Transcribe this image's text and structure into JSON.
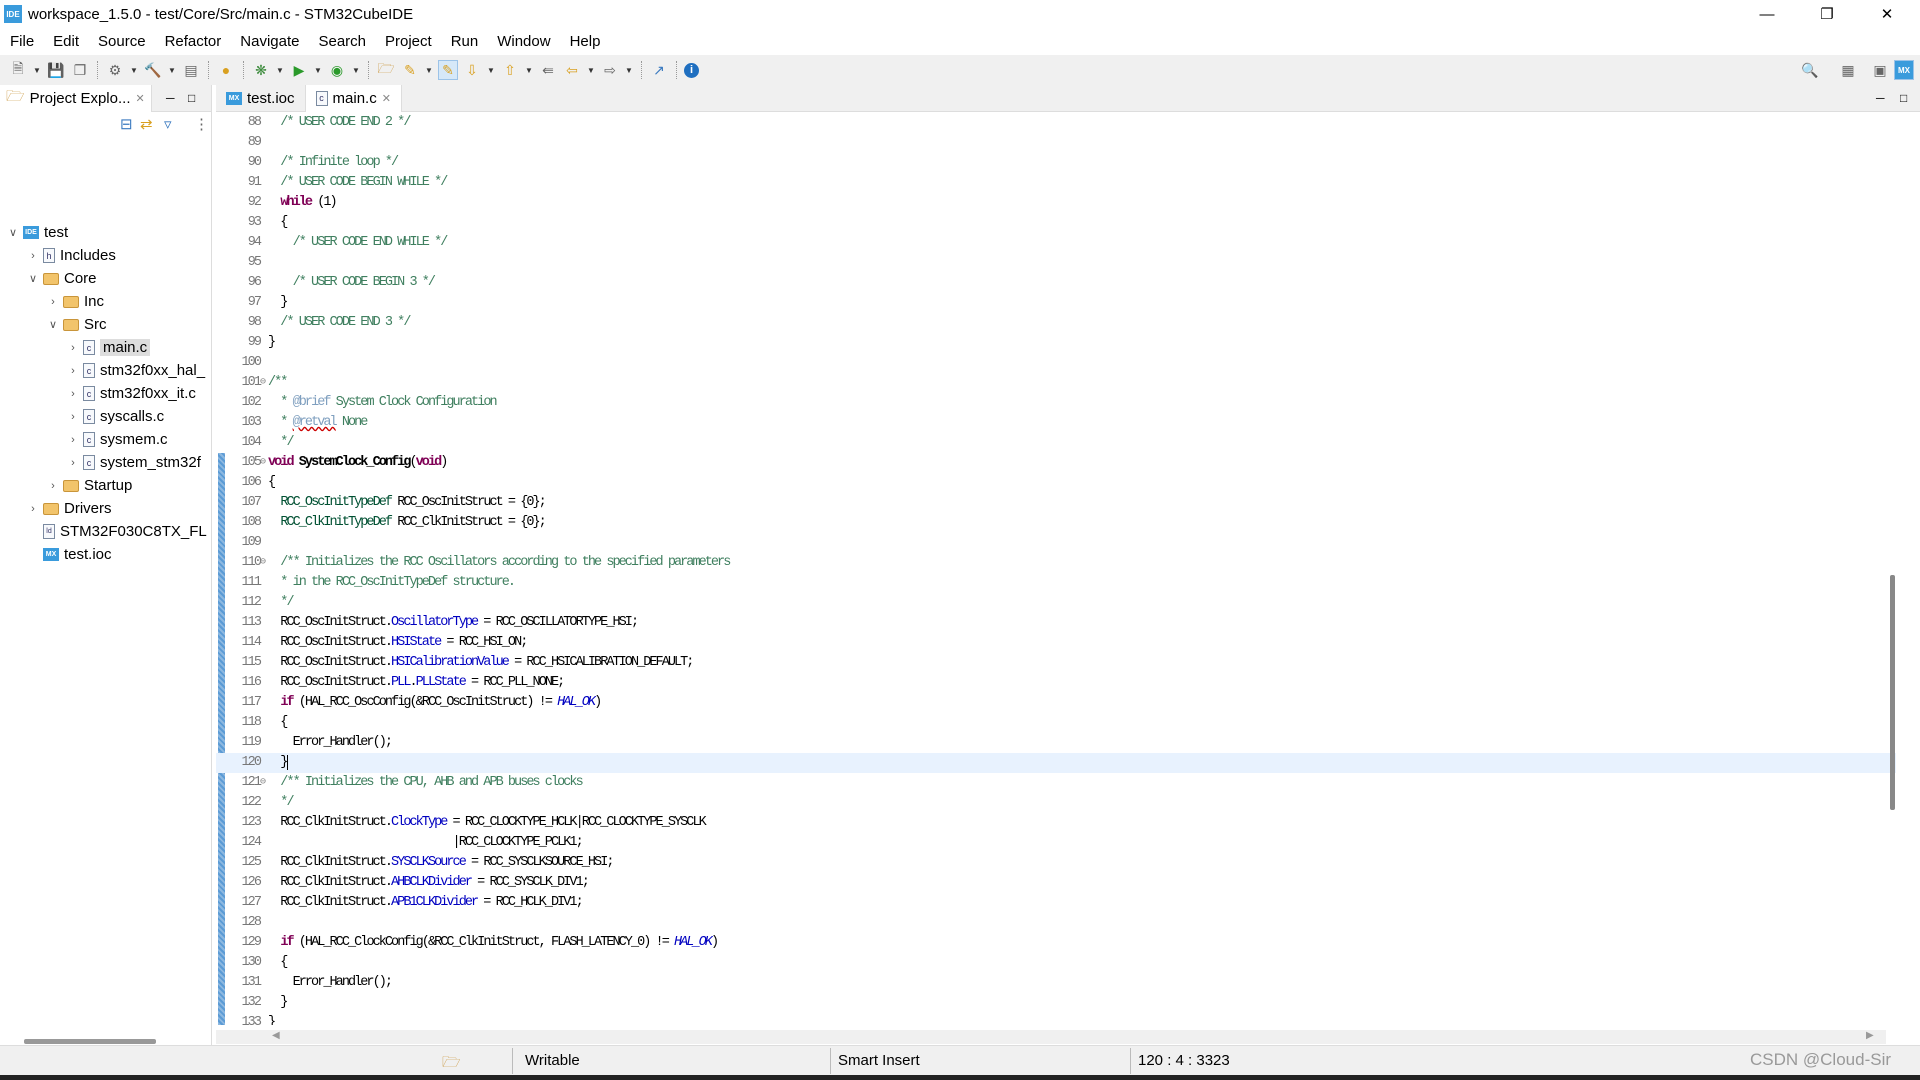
{
  "window": {
    "title": "workspace_1.5.0 - test/Core/Src/main.c - STM32CubeIDE",
    "logo": "IDE",
    "controls": [
      "minimize-icon",
      "restore-icon",
      "close-icon"
    ]
  },
  "menu": [
    "File",
    "Edit",
    "Source",
    "Refactor",
    "Navigate",
    "Search",
    "Project",
    "Run",
    "Window",
    "Help"
  ],
  "project_explorer": {
    "tab_label": "Project Explo...",
    "items": [
      {
        "label": "test",
        "depth": 0,
        "icon": "ide",
        "expanded": true
      },
      {
        "label": "Includes",
        "depth": 1,
        "icon": "includes",
        "expanded": false
      },
      {
        "label": "Core",
        "depth": 1,
        "icon": "folder",
        "expanded": true
      },
      {
        "label": "Inc",
        "depth": 2,
        "icon": "folder",
        "expanded": false
      },
      {
        "label": "Src",
        "depth": 2,
        "icon": "folder",
        "expanded": true
      },
      {
        "label": "main.c",
        "depth": 3,
        "icon": "c",
        "expanded": false,
        "selected": true
      },
      {
        "label": "stm32f0xx_hal_",
        "depth": 3,
        "icon": "c",
        "expanded": false
      },
      {
        "label": "stm32f0xx_it.c",
        "depth": 3,
        "icon": "c",
        "expanded": false
      },
      {
        "label": "syscalls.c",
        "depth": 3,
        "icon": "c",
        "expanded": false
      },
      {
        "label": "sysmem.c",
        "depth": 3,
        "icon": "c",
        "expanded": false
      },
      {
        "label": "system_stm32f",
        "depth": 3,
        "icon": "c",
        "expanded": false
      },
      {
        "label": "Startup",
        "depth": 2,
        "icon": "folder",
        "expanded": false
      },
      {
        "label": "Drivers",
        "depth": 1,
        "icon": "folder",
        "expanded": false
      },
      {
        "label": "STM32F030C8TX_FL",
        "depth": 1,
        "icon": "ld"
      },
      {
        "label": "test.ioc",
        "depth": 1,
        "icon": "mx"
      }
    ]
  },
  "editor": {
    "tabs": [
      {
        "label": "test.ioc",
        "icon": "MX",
        "active": false
      },
      {
        "label": "main.c",
        "icon": "c",
        "active": true
      }
    ],
    "current_line": 120,
    "lines": [
      {
        "n": 88,
        "t": [
          [
            "  /* USER CODE END 2 */",
            "c"
          ]
        ]
      },
      {
        "n": 89,
        "t": []
      },
      {
        "n": 90,
        "t": [
          [
            "  /* Infinite loop */",
            "c"
          ]
        ]
      },
      {
        "n": 91,
        "t": [
          [
            "  /* USER CODE BEGIN WHILE */",
            "c"
          ]
        ]
      },
      {
        "n": 92,
        "t": [
          [
            "  ",
            ""
          ],
          [
            "while",
            "k"
          ],
          [
            " (1)",
            ""
          ]
        ]
      },
      {
        "n": 93,
        "t": [
          [
            "  {",
            ""
          ]
        ]
      },
      {
        "n": 94,
        "t": [
          [
            "    /* USER CODE END WHILE */",
            "c"
          ]
        ]
      },
      {
        "n": 95,
        "t": []
      },
      {
        "n": 96,
        "t": [
          [
            "    /* USER CODE BEGIN 3 */",
            "c"
          ]
        ]
      },
      {
        "n": 97,
        "t": [
          [
            "  }",
            ""
          ]
        ]
      },
      {
        "n": 98,
        "t": [
          [
            "  /* USER CODE END 3 */",
            "c"
          ]
        ]
      },
      {
        "n": 99,
        "t": [
          [
            "}",
            ""
          ]
        ]
      },
      {
        "n": 100,
        "t": []
      },
      {
        "n": 101,
        "fold": true,
        "t": [
          [
            "/**",
            "c"
          ]
        ]
      },
      {
        "n": 102,
        "t": [
          [
            "  * ",
            "c"
          ],
          [
            "@brief",
            "tag"
          ],
          [
            " System Clock Configuration",
            "c"
          ]
        ]
      },
      {
        "n": 103,
        "t": [
          [
            "  * ",
            "c"
          ],
          [
            "@retval",
            "tagu"
          ],
          [
            " None",
            "c"
          ]
        ]
      },
      {
        "n": 104,
        "t": [
          [
            "  */",
            "c"
          ]
        ]
      },
      {
        "n": 105,
        "fold": true,
        "t": [
          [
            "void",
            "k"
          ],
          [
            " ",
            ""
          ],
          [
            "SystemClock_Config",
            "b"
          ],
          [
            "(",
            ""
          ],
          [
            "void",
            "k"
          ],
          [
            ")",
            ""
          ]
        ]
      },
      {
        "n": 106,
        "t": [
          [
            "{",
            ""
          ]
        ]
      },
      {
        "n": 107,
        "t": [
          [
            "  ",
            ""
          ],
          [
            "RCC_OscInitTypeDef",
            "t"
          ],
          [
            " RCC_OscInitStruct = {0};",
            ""
          ]
        ]
      },
      {
        "n": 108,
        "t": [
          [
            "  ",
            ""
          ],
          [
            "RCC_ClkInitTypeDef",
            "t"
          ],
          [
            " RCC_ClkInitStruct = {0};",
            ""
          ]
        ]
      },
      {
        "n": 109,
        "t": []
      },
      {
        "n": 110,
        "fold": true,
        "t": [
          [
            "  /** Initializes the RCC Oscillators according to the specified parameters",
            "c"
          ]
        ]
      },
      {
        "n": 111,
        "t": [
          [
            "  * in the RCC_OscInitTypeDef structure.",
            "c"
          ]
        ]
      },
      {
        "n": 112,
        "t": [
          [
            "  */",
            "c"
          ]
        ]
      },
      {
        "n": 113,
        "t": [
          [
            "  RCC_OscInitStruct.",
            ""
          ],
          [
            "OscillatorType",
            "f"
          ],
          [
            " = RCC_OSCILLATORTYPE_HSI;",
            ""
          ]
        ]
      },
      {
        "n": 114,
        "t": [
          [
            "  RCC_OscInitStruct.",
            ""
          ],
          [
            "HSIState",
            "f"
          ],
          [
            " = RCC_HSI_ON;",
            ""
          ]
        ]
      },
      {
        "n": 115,
        "t": [
          [
            "  RCC_OscInitStruct.",
            ""
          ],
          [
            "HSICalibrationValue",
            "f"
          ],
          [
            " = RCC_HSICALIBRATION_DEFAULT;",
            ""
          ]
        ]
      },
      {
        "n": 116,
        "t": [
          [
            "  RCC_OscInitStruct.",
            ""
          ],
          [
            "PLL",
            "f"
          ],
          [
            ".",
            ""
          ],
          [
            "PLLState",
            "f"
          ],
          [
            " = RCC_PLL_NONE;",
            ""
          ]
        ]
      },
      {
        "n": 117,
        "t": [
          [
            "  ",
            ""
          ],
          [
            "if",
            "k"
          ],
          [
            " (HAL_RCC_OscConfig(&RCC_OscInitStruct) != ",
            ""
          ],
          [
            "HAL_OK",
            "m"
          ],
          [
            ")",
            ""
          ]
        ]
      },
      {
        "n": 118,
        "t": [
          [
            "  {",
            ""
          ]
        ]
      },
      {
        "n": 119,
        "t": [
          [
            "    Error_Handler();",
            ""
          ]
        ]
      },
      {
        "n": 120,
        "t": [
          [
            "  }",
            ""
          ]
        ]
      },
      {
        "n": 121,
        "fold": true,
        "t": [
          [
            "  /** Initializes the CPU, AHB and APB buses clocks",
            "c"
          ]
        ]
      },
      {
        "n": 122,
        "t": [
          [
            "  */",
            "c"
          ]
        ]
      },
      {
        "n": 123,
        "t": [
          [
            "  RCC_ClkInitStruct.",
            ""
          ],
          [
            "ClockType",
            "f"
          ],
          [
            " = RCC_CLOCKTYPE_HCLK|RCC_CLOCKTYPE_SYSCLK",
            ""
          ]
        ]
      },
      {
        "n": 124,
        "t": [
          [
            "                              |RCC_CLOCKTYPE_PCLK1;",
            ""
          ]
        ]
      },
      {
        "n": 125,
        "t": [
          [
            "  RCC_ClkInitStruct.",
            ""
          ],
          [
            "SYSCLKSource",
            "f"
          ],
          [
            " = RCC_SYSCLKSOURCE_HSI;",
            ""
          ]
        ]
      },
      {
        "n": 126,
        "t": [
          [
            "  RCC_ClkInitStruct.",
            ""
          ],
          [
            "AHBCLKDivider",
            "f"
          ],
          [
            " = RCC_SYSCLK_DIV1;",
            ""
          ]
        ]
      },
      {
        "n": 127,
        "t": [
          [
            "  RCC_ClkInitStruct.",
            ""
          ],
          [
            "APB1CLKDivider",
            "f"
          ],
          [
            " = RCC_HCLK_DIV1;",
            ""
          ]
        ]
      },
      {
        "n": 128,
        "t": []
      },
      {
        "n": 129,
        "t": [
          [
            "  ",
            ""
          ],
          [
            "if",
            "k"
          ],
          [
            " (HAL_RCC_ClockConfig(&RCC_ClkInitStruct, FLASH_LATENCY_0) != ",
            ""
          ],
          [
            "HAL_OK",
            "m"
          ],
          [
            ")",
            ""
          ]
        ]
      },
      {
        "n": 130,
        "t": [
          [
            "  {",
            ""
          ]
        ]
      },
      {
        "n": 131,
        "t": [
          [
            "    Error_Handler();",
            ""
          ]
        ]
      },
      {
        "n": 132,
        "t": [
          [
            "  }",
            ""
          ]
        ]
      },
      {
        "n": 133,
        "t": [
          [
            "}",
            ""
          ]
        ]
      }
    ]
  },
  "status": {
    "mode": "Writable",
    "insert": "Smart Insert",
    "position": "120 : 4 : 3323"
  },
  "watermark": "CSDN @Cloud-Sir",
  "colors": {
    "comment": "#3f7f5f",
    "keyword": "#7f0055",
    "field": "#0000c0",
    "type": "#005032",
    "current_line": "#e8f2fe",
    "accent": "#3a9bdc"
  }
}
